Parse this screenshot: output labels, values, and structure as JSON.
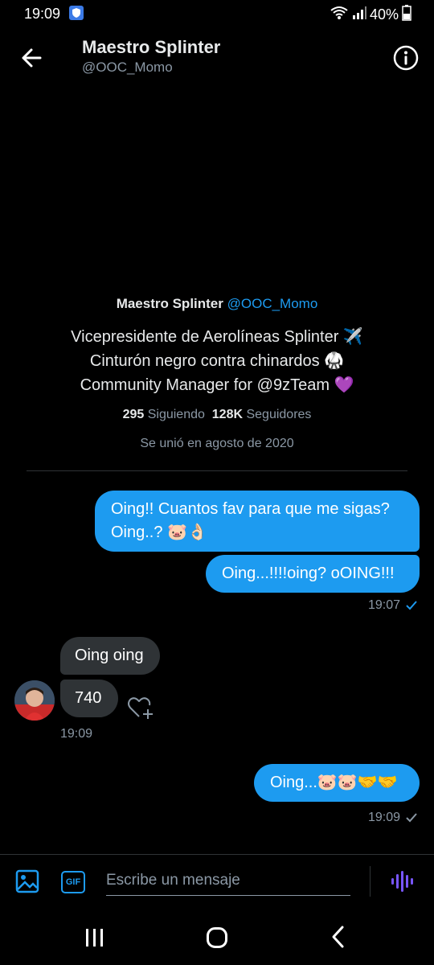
{
  "status_bar": {
    "time": "19:09",
    "battery": "40%"
  },
  "header": {
    "title": "Maestro Splinter",
    "handle": "@OOC_Momo"
  },
  "profile": {
    "name": "Maestro Splinter",
    "handle": "@OOC_Momo",
    "bio_lines": [
      "Vicepresidente de Aerolíneas Splinter ✈️",
      "Cinturón negro contra chinardos 🥋",
      "Community Manager for @9zTeam 💜"
    ],
    "following_count": "295",
    "following_label": "Siguiendo",
    "followers_count": "128K",
    "followers_label": "Seguidores",
    "joined": "Se unió en agosto de 2020"
  },
  "messages": [
    {
      "direction": "out",
      "text": "Oing!! Cuantos fav para que me sigas? Oing..? 🐷👌🏻"
    },
    {
      "direction": "out",
      "text": "Oing...!!!!oing? oOING!!!"
    },
    {
      "direction": "in",
      "text": "Oing oing"
    },
    {
      "direction": "in",
      "text": "740"
    },
    {
      "direction": "out",
      "text": "Oing...🐷🐷🤝🤝"
    }
  ],
  "timestamps": {
    "group1": "19:07",
    "group2": "19:09",
    "group3": "19:09"
  },
  "composer": {
    "placeholder": "Escribe un mensaje",
    "gif_label": "GIF"
  },
  "colors": {
    "accent": "#1d9bf0",
    "background": "#000000",
    "incoming_bubble": "#2f3336",
    "muted_text": "#8b98a5",
    "voice_icon": "#7856ff"
  }
}
